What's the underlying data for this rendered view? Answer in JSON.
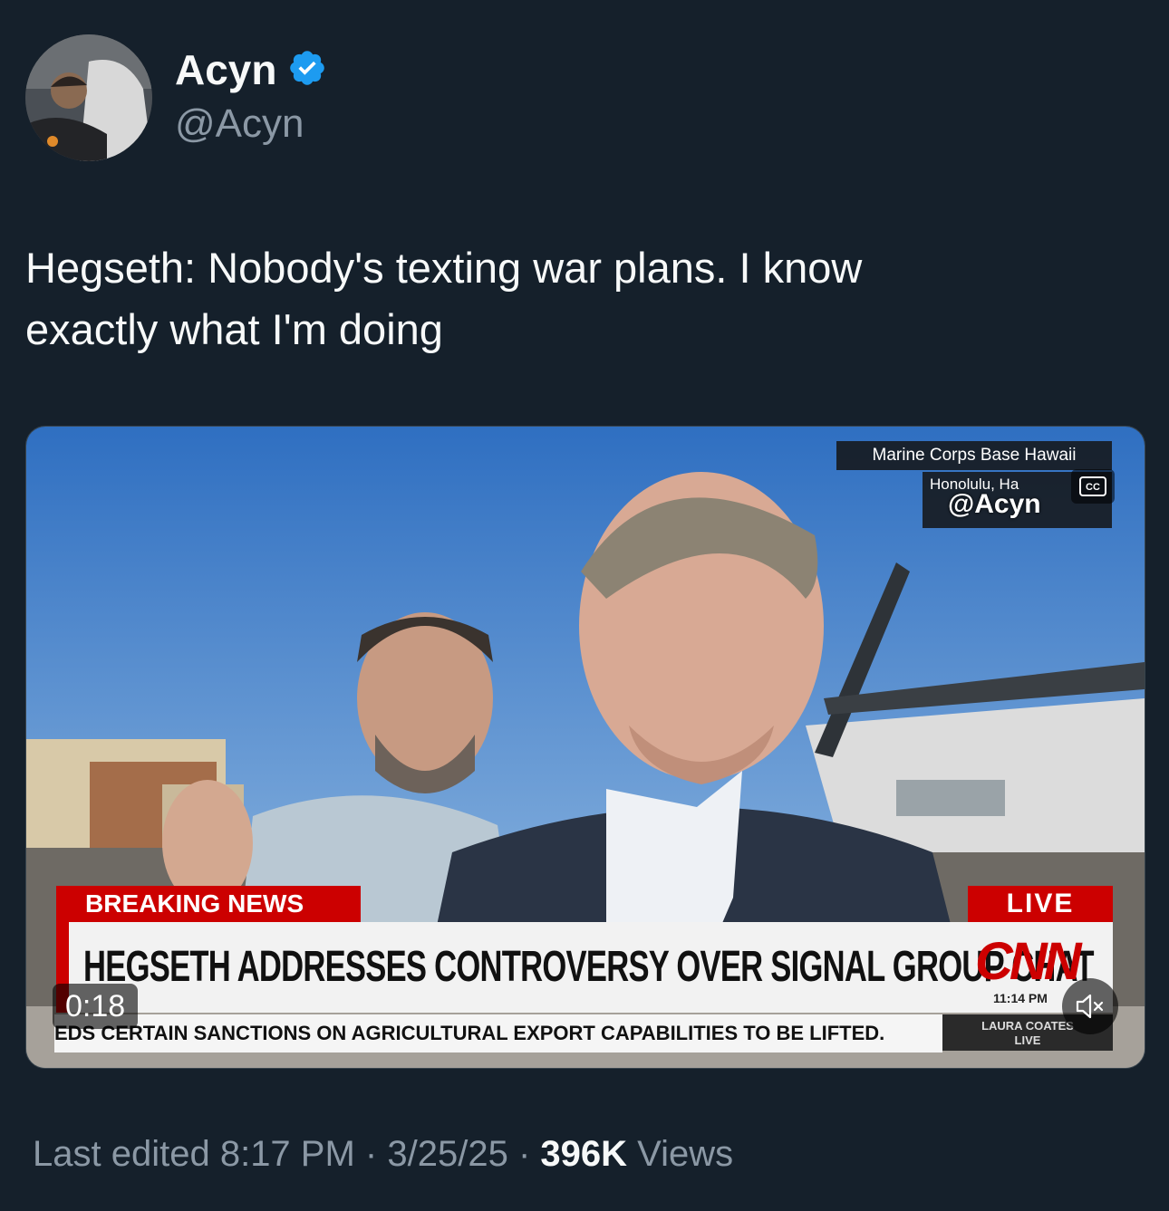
{
  "author": {
    "display_name": "Acyn",
    "handle": "@Acyn",
    "verified": true,
    "verified_color": "#1d9bf0"
  },
  "tweet": {
    "text_line1": "Hegseth: Nobody's texting war plans. I know",
    "text_line2": "exactly what I'm doing"
  },
  "video": {
    "location_line1": "Marine Corps Base Hawaii",
    "location_line2": "Honolulu, Ha",
    "watermark": "@Acyn",
    "breaking_label": "BREAKING NEWS",
    "live_label": "LIVE",
    "headline": "HEGSETH ADDRESSES CONTROVERSY OVER SIGNAL GROUP CHAT",
    "network_logo": "CNN",
    "news_time": "11:14 PM",
    "ticker": "EDS CERTAIN SANCTIONS ON AGRICULTURAL EXPORT CAPABILITIES TO BE LIFTED.",
    "show_name": "LAURA COATES",
    "show_status": "LIVE",
    "duration": "0:18",
    "cc_label": "CC",
    "mute_icon": "speaker-muted-icon",
    "accent_color": "#cc0000"
  },
  "meta": {
    "edited_label": "Last edited",
    "time": "8:17 PM",
    "separator": "·",
    "date": "3/25/25",
    "views_count": "396K",
    "views_label": "Views"
  }
}
